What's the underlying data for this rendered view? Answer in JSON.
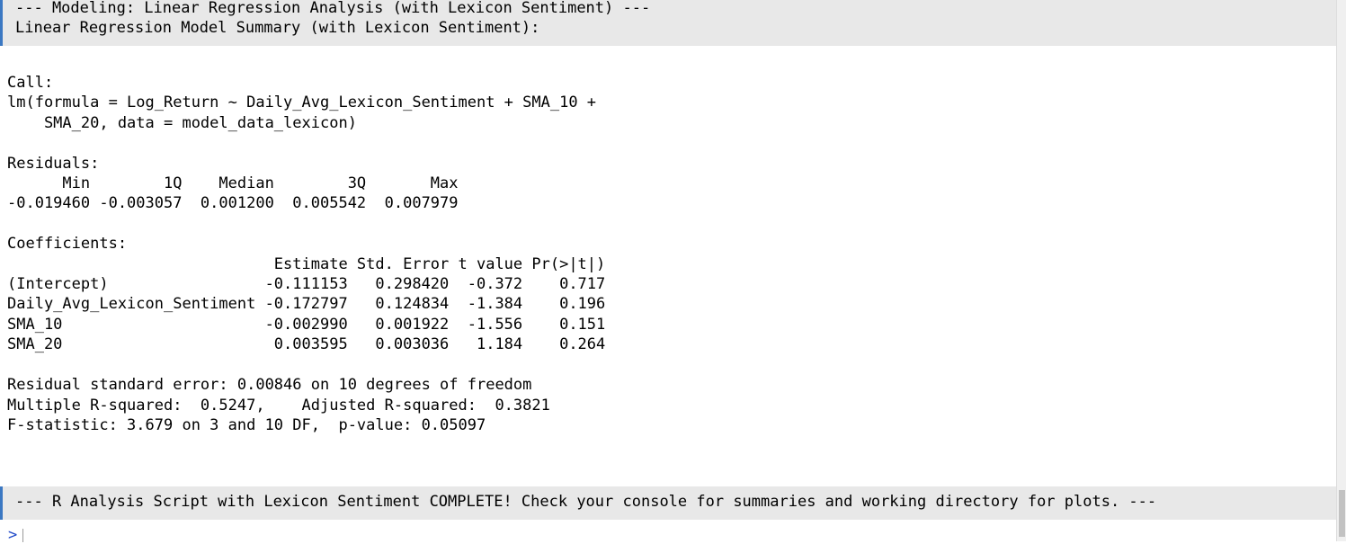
{
  "console": {
    "header_lines": [
      "--- Modeling: Linear Regression Analysis (with Lexicon Sentiment) ---",
      "Linear Regression Model Summary (with Lexicon Sentiment):"
    ],
    "output_lines": [
      "Call:",
      "lm(formula = Log_Return ~ Daily_Avg_Lexicon_Sentiment + SMA_10 +",
      "    SMA_20, data = model_data_lexicon)",
      "",
      "Residuals:",
      "      Min        1Q    Median        3Q       Max ",
      "-0.019460 -0.003057  0.001200  0.005542  0.007979 ",
      "",
      "Coefficients:",
      "                             Estimate Std. Error t value Pr(>|t|)",
      "(Intercept)                 -0.111153   0.298420  -0.372    0.717",
      "Daily_Avg_Lexicon_Sentiment -0.172797   0.124834  -1.384    0.196",
      "SMA_10                      -0.002990   0.001922  -1.556    0.151",
      "SMA_20                       0.003595   0.003036   1.184    0.264",
      "",
      "Residual standard error: 0.00846 on 10 degrees of freedom",
      "Multiple R-squared:  0.5247,\tAdjusted R-squared:  0.3821 ",
      "F-statistic: 3.679 on 3 and 10 DF,  p-value: 0.05097"
    ],
    "footer_line": "--- R Analysis Script with Lexicon Sentiment COMPLETE! Check your console for summaries and working directory for plots. ---",
    "prompt_symbol": ">"
  },
  "colors": {
    "message_background": "#e8e8e8",
    "message_accent": "#3b78c2",
    "prompt": "#1e48c8",
    "text": "#000000"
  }
}
